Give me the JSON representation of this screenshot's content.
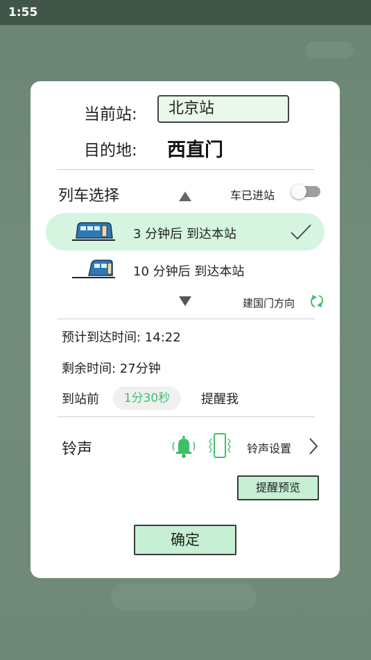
{
  "status_bar": {
    "time": "1:55"
  },
  "dialog": {
    "current_station_label": "当前站:",
    "current_station_value": "北京站",
    "destination_label": "目的地:",
    "destination_value": "西直门",
    "train_select_label": "列车选择",
    "arrived_label": "车已进站",
    "arrived_toggle_on": false,
    "trains": [
      {
        "text": "3 分钟后 到达本站",
        "selected": true
      },
      {
        "text": "10 分钟后 到达本站",
        "selected": false
      }
    ],
    "direction_label": "建国门方向",
    "eta_label": "预计到达时间: 14:22",
    "remaining_label": "剩余时间: 27分钟",
    "remind_before_label": "到站前",
    "remind_value": "1分30秒",
    "remind_suffix": "提醒我",
    "ringtone_label": "铃声",
    "ringtone_settings_label": "铃声设置",
    "preview_button": "提醒预览",
    "confirm_button": "确定"
  },
  "colors": {
    "accent": "#3fbf6a",
    "selected_row": "#d5f5e1",
    "button_bg": "#c6efd4"
  }
}
